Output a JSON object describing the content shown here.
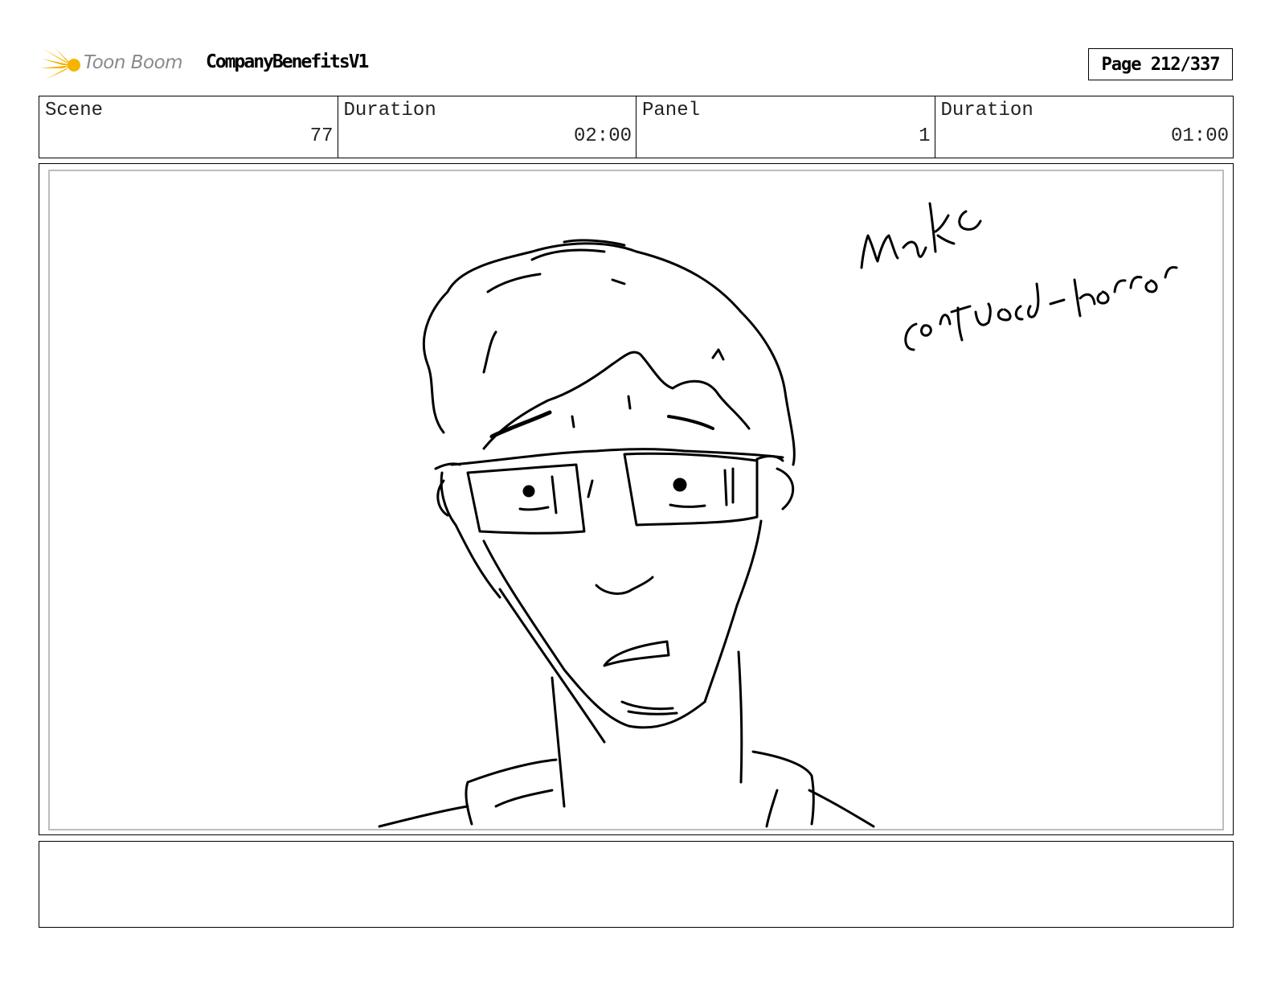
{
  "header": {
    "logo_text": "Toon Boom",
    "project_title": "CompanyBenefitsV1",
    "page_label": "Page 212/337"
  },
  "info": {
    "scene_label": "Scene",
    "scene_value": "77",
    "scene_duration_label": "Duration",
    "scene_duration_value": "02:00",
    "panel_label": "Panel",
    "panel_value": "1",
    "panel_duration_label": "Duration",
    "panel_duration_value": "01:00"
  },
  "panel": {
    "handwritten_note_line1": "make",
    "handwritten_note_line2": "confused-horror"
  },
  "notes": {
    "text": ""
  },
  "colors": {
    "logo_star": "#f5b400",
    "logo_text": "#8a8a8a",
    "panel_inner_border": "#bdbdbd"
  }
}
